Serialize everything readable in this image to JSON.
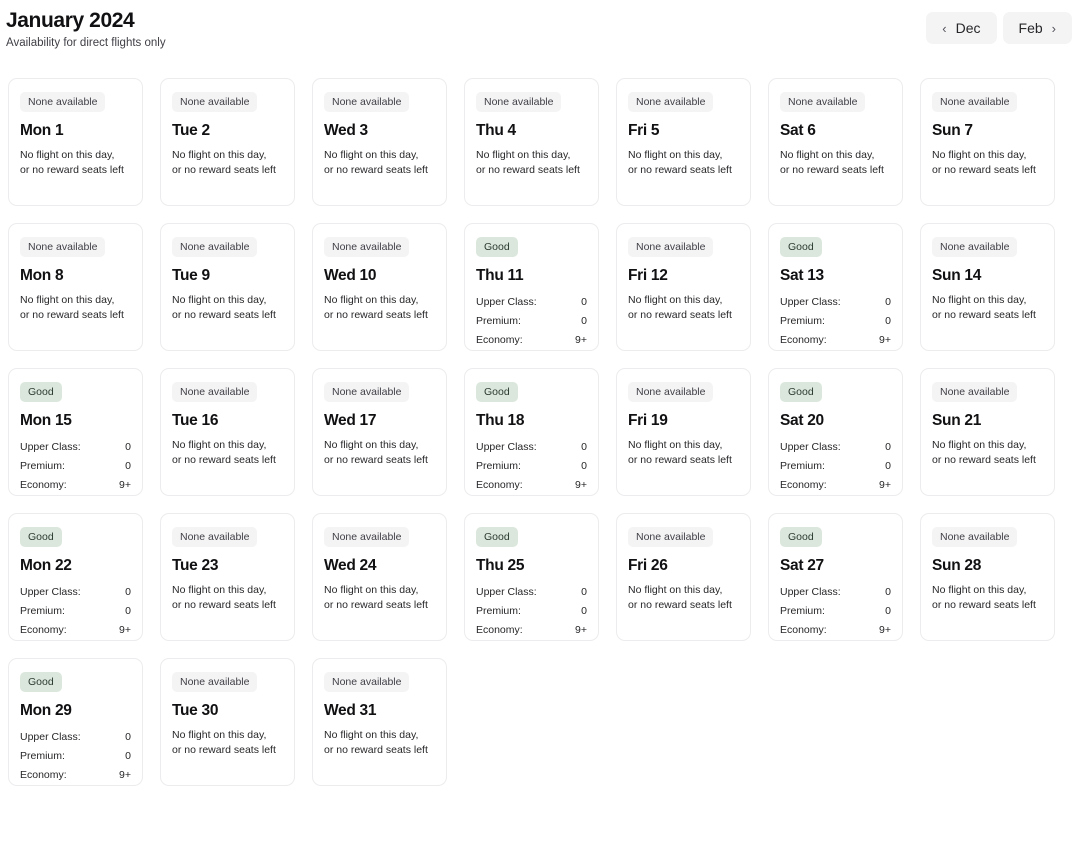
{
  "header": {
    "month_title": "January 2024",
    "subtitle": "Availability for direct flights only",
    "prev_button": {
      "label": "Dec",
      "icon": "chevron-left-icon",
      "glyph": "‹"
    },
    "next_button": {
      "label": "Feb",
      "icon": "chevron-right-icon",
      "glyph": "›"
    }
  },
  "labels": {
    "none_available": "None available",
    "good": "Good",
    "no_flight_text": "No flight on this day,\nor no reward seats left",
    "upper_class": "Upper Class:",
    "premium": "Premium:",
    "economy": "Economy:"
  },
  "colors": {
    "badge_none_bg": "#f4f4f5",
    "badge_none_text": "#3f3f46",
    "badge_good_bg": "#dbe7dd",
    "badge_good_text": "#2b3b2f",
    "card_bg": "#ffffff",
    "card_border": "#ececee",
    "nav_button_bg": "#f4f4f5",
    "text_primary": "#111113",
    "text_secondary": "#27272a",
    "page_bg": "#ffffff"
  },
  "calendar": {
    "columns": 7,
    "rows": 5,
    "days": [
      {
        "day_label": "Mon 1",
        "status": "none",
        "status_label": "None available",
        "note": "No flight on this day,\nor no reward seats left"
      },
      {
        "day_label": "Tue 2",
        "status": "none",
        "status_label": "None available",
        "note": "No flight on this day,\nor no reward seats left"
      },
      {
        "day_label": "Wed 3",
        "status": "none",
        "status_label": "None available",
        "note": "No flight on this day,\nor no reward seats left"
      },
      {
        "day_label": "Thu 4",
        "status": "none",
        "status_label": "None available",
        "note": "No flight on this day,\nor no reward seats left"
      },
      {
        "day_label": "Fri 5",
        "status": "none",
        "status_label": "None available",
        "note": "No flight on this day,\nor no reward seats left"
      },
      {
        "day_label": "Sat 6",
        "status": "none",
        "status_label": "None available",
        "note": "No flight on this day,\nor no reward seats left"
      },
      {
        "day_label": "Sun 7",
        "status": "none",
        "status_label": "None available",
        "note": "No flight on this day,\nor no reward seats left"
      },
      {
        "day_label": "Mon 8",
        "status": "none",
        "status_label": "None available",
        "note": "No flight on this day,\nor no reward seats left"
      },
      {
        "day_label": "Tue 9",
        "status": "none",
        "status_label": "None available",
        "note": "No flight on this day,\nor no reward seats left"
      },
      {
        "day_label": "Wed 10",
        "status": "none",
        "status_label": "None available",
        "note": "No flight on this day,\nor no reward seats left"
      },
      {
        "day_label": "Thu 11",
        "status": "good",
        "status_label": "Good",
        "classes": [
          {
            "name": "Upper Class:",
            "value": "0"
          },
          {
            "name": "Premium:",
            "value": "0"
          },
          {
            "name": "Economy:",
            "value": "9+"
          }
        ]
      },
      {
        "day_label": "Fri 12",
        "status": "none",
        "status_label": "None available",
        "note": "No flight on this day,\nor no reward seats left"
      },
      {
        "day_label": "Sat 13",
        "status": "good",
        "status_label": "Good",
        "classes": [
          {
            "name": "Upper Class:",
            "value": "0"
          },
          {
            "name": "Premium:",
            "value": "0"
          },
          {
            "name": "Economy:",
            "value": "9+"
          }
        ]
      },
      {
        "day_label": "Sun 14",
        "status": "none",
        "status_label": "None available",
        "note": "No flight on this day,\nor no reward seats left"
      },
      {
        "day_label": "Mon 15",
        "status": "good",
        "status_label": "Good",
        "classes": [
          {
            "name": "Upper Class:",
            "value": "0"
          },
          {
            "name": "Premium:",
            "value": "0"
          },
          {
            "name": "Economy:",
            "value": "9+"
          }
        ]
      },
      {
        "day_label": "Tue 16",
        "status": "none",
        "status_label": "None available",
        "note": "No flight on this day,\nor no reward seats left"
      },
      {
        "day_label": "Wed 17",
        "status": "none",
        "status_label": "None available",
        "note": "No flight on this day,\nor no reward seats left"
      },
      {
        "day_label": "Thu 18",
        "status": "good",
        "status_label": "Good",
        "classes": [
          {
            "name": "Upper Class:",
            "value": "0"
          },
          {
            "name": "Premium:",
            "value": "0"
          },
          {
            "name": "Economy:",
            "value": "9+"
          }
        ]
      },
      {
        "day_label": "Fri 19",
        "status": "none",
        "status_label": "None available",
        "note": "No flight on this day,\nor no reward seats left"
      },
      {
        "day_label": "Sat 20",
        "status": "good",
        "status_label": "Good",
        "classes": [
          {
            "name": "Upper Class:",
            "value": "0"
          },
          {
            "name": "Premium:",
            "value": "0"
          },
          {
            "name": "Economy:",
            "value": "9+"
          }
        ]
      },
      {
        "day_label": "Sun 21",
        "status": "none",
        "status_label": "None available",
        "note": "No flight on this day,\nor no reward seats left"
      },
      {
        "day_label": "Mon 22",
        "status": "good",
        "status_label": "Good",
        "classes": [
          {
            "name": "Upper Class:",
            "value": "0"
          },
          {
            "name": "Premium:",
            "value": "0"
          },
          {
            "name": "Economy:",
            "value": "9+"
          }
        ]
      },
      {
        "day_label": "Tue 23",
        "status": "none",
        "status_label": "None available",
        "note": "No flight on this day,\nor no reward seats left"
      },
      {
        "day_label": "Wed 24",
        "status": "none",
        "status_label": "None available",
        "note": "No flight on this day,\nor no reward seats left"
      },
      {
        "day_label": "Thu 25",
        "status": "good",
        "status_label": "Good",
        "classes": [
          {
            "name": "Upper Class:",
            "value": "0"
          },
          {
            "name": "Premium:",
            "value": "0"
          },
          {
            "name": "Economy:",
            "value": "9+"
          }
        ]
      },
      {
        "day_label": "Fri 26",
        "status": "none",
        "status_label": "None available",
        "note": "No flight on this day,\nor no reward seats left"
      },
      {
        "day_label": "Sat 27",
        "status": "good",
        "status_label": "Good",
        "classes": [
          {
            "name": "Upper Class:",
            "value": "0"
          },
          {
            "name": "Premium:",
            "value": "0"
          },
          {
            "name": "Economy:",
            "value": "9+"
          }
        ]
      },
      {
        "day_label": "Sun 28",
        "status": "none",
        "status_label": "None available",
        "note": "No flight on this day,\nor no reward seats left"
      },
      {
        "day_label": "Mon 29",
        "status": "good",
        "status_label": "Good",
        "classes": [
          {
            "name": "Upper Class:",
            "value": "0"
          },
          {
            "name": "Premium:",
            "value": "0"
          },
          {
            "name": "Economy:",
            "value": "9+"
          }
        ]
      },
      {
        "day_label": "Tue 30",
        "status": "none",
        "status_label": "None available",
        "note": "No flight on this day,\nor no reward seats left"
      },
      {
        "day_label": "Wed 31",
        "status": "none",
        "status_label": "None available",
        "note": "No flight on this day,\nor no reward seats left"
      }
    ]
  }
}
